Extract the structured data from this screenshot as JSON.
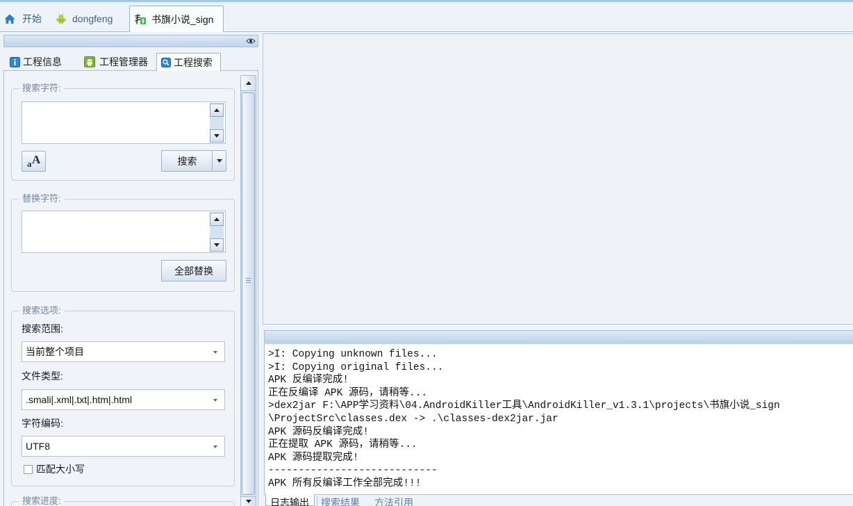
{
  "top_tabs": [
    {
      "label": "开始",
      "icon": "home-icon",
      "active": false
    },
    {
      "label": "dongfeng",
      "icon": "android-icon",
      "active": false
    },
    {
      "label": "书旗小说_sign",
      "icon": "app-icon",
      "active": true
    }
  ],
  "project_panel": {
    "header_icon": "eye-icon",
    "tabs": [
      {
        "label": "工程信息",
        "icon": "info-icon",
        "active": false
      },
      {
        "label": "工程管理器",
        "icon": "android-icon",
        "active": false
      },
      {
        "label": "工程搜索",
        "icon": "search-icon",
        "active": true
      }
    ],
    "search": {
      "title": "搜索字符:",
      "text": "",
      "case_icon": {
        "name": "font-case-icon",
        "small": "a",
        "large": "A"
      },
      "search_button": "搜索"
    },
    "replace": {
      "title": "替换字符:",
      "text": "",
      "replace_all_button": "全部替换"
    },
    "options": {
      "title": "搜索选项:",
      "scope": {
        "label": "搜索范围:",
        "value": "当前整个项目"
      },
      "file_type": {
        "label": "文件类型:",
        "value": ".smali|.xml|.txt|.htm|.html"
      },
      "encoding": {
        "label": "字符编码:",
        "value": "UTF8"
      },
      "match_case": {
        "label": "匹配大小写",
        "checked": false
      }
    },
    "progress": {
      "title": "搜索进度:"
    }
  },
  "log": {
    "lines": [
      ">I: Copying unknown files...",
      ">I: Copying original files...",
      "APK 反编译完成!",
      "正在反编译 APK 源码，请稍等...",
      ">dex2jar F:\\APP学习资料\\04.AndroidKiller工具\\AndroidKiller_v1.3.1\\projects\\书旗小说_sign",
      "\\ProjectSrc\\classes.dex -> .\\classes-dex2jar.jar",
      "APK 源码反编译完成!",
      "正在提取 APK 源码，请稍等...",
      "APK 源码提取完成!",
      "----------------------------",
      "APK 所有反编译工作全部完成!!!"
    ],
    "tabs": [
      {
        "label": "日志输出",
        "active": true
      },
      {
        "label": "搜索结果",
        "active": false
      },
      {
        "label": "方法引用",
        "active": false
      }
    ]
  },
  "colors": {
    "border": "#a9bfd8",
    "bar_top": "#dce8f6",
    "bar_bottom": "#c2d5ed",
    "active_tab_bg": "#fbfcfe",
    "group_title": "#7288a6",
    "tab_text": "#3a5f8c",
    "inactive_bottom_tab": "#5b7db0"
  }
}
